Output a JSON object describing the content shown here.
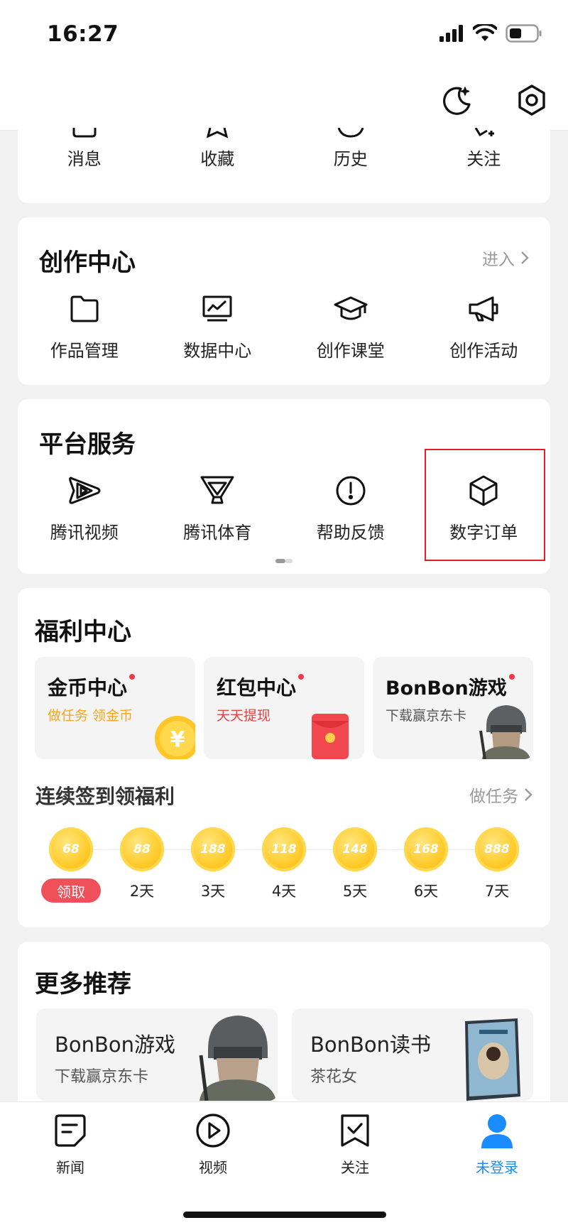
{
  "status_bar": {
    "time": "16:27"
  },
  "top_bar": {
    "icons": [
      "moon-icon",
      "settings-icon"
    ]
  },
  "quick_actions": [
    {
      "label": "消息",
      "icon": "message-icon"
    },
    {
      "label": "收藏",
      "icon": "star-icon"
    },
    {
      "label": "历史",
      "icon": "history-icon"
    },
    {
      "label": "关注",
      "icon": "follow-icon"
    }
  ],
  "creation_center": {
    "title": "创作中心",
    "more_label": "进入",
    "items": [
      {
        "label": "作品管理",
        "icon": "folder-icon"
      },
      {
        "label": "数据中心",
        "icon": "chart-icon"
      },
      {
        "label": "创作课堂",
        "icon": "graduation-cap-icon"
      },
      {
        "label": "创作活动",
        "icon": "megaphone-icon"
      }
    ]
  },
  "platform_services": {
    "title": "平台服务",
    "items": [
      {
        "label": "腾讯视频",
        "icon": "tencent-video-icon"
      },
      {
        "label": "腾讯体育",
        "icon": "trophy-icon"
      },
      {
        "label": "帮助反馈",
        "icon": "exclamation-circle-icon"
      },
      {
        "label": "数字订单",
        "icon": "box-icon"
      }
    ],
    "highlighted_item": "数字订单"
  },
  "welfare_center": {
    "title": "福利中心",
    "tiles": [
      {
        "title": "金币中心",
        "subtitle": "做任务 领金币",
        "subtitle_color": "#f5a623"
      },
      {
        "title": "红包中心",
        "subtitle": "天天提现",
        "subtitle_color": "#e8403f"
      },
      {
        "title": "BonBon游戏",
        "subtitle": "下载赢京东卡",
        "subtitle_color": "#555555"
      }
    ],
    "signin": {
      "title": "连续签到领福利",
      "more_label": "做任务",
      "days": [
        {
          "value": "68",
          "label": "领取"
        },
        {
          "value": "88",
          "label": "2天"
        },
        {
          "value": "188",
          "label": "3天"
        },
        {
          "value": "118",
          "label": "4天"
        },
        {
          "value": "148",
          "label": "5天"
        },
        {
          "value": "168",
          "label": "6天"
        },
        {
          "value": "888",
          "label": "7天"
        }
      ]
    }
  },
  "more_recommend": {
    "title": "更多推荐",
    "tiles": [
      {
        "title": "BonBon游戏",
        "subtitle": "下载赢京东卡"
      },
      {
        "title": "BonBon读书",
        "subtitle": "茶花女"
      }
    ]
  },
  "tab_bar": {
    "tabs": [
      {
        "label": "新闻",
        "icon": "news-icon",
        "active": false
      },
      {
        "label": "视频",
        "icon": "play-icon",
        "active": false
      },
      {
        "label": "关注",
        "icon": "bookmark-check-icon",
        "active": false
      },
      {
        "label": "未登录",
        "icon": "user-icon",
        "active": true
      }
    ],
    "active_color": "#1a8cff"
  }
}
